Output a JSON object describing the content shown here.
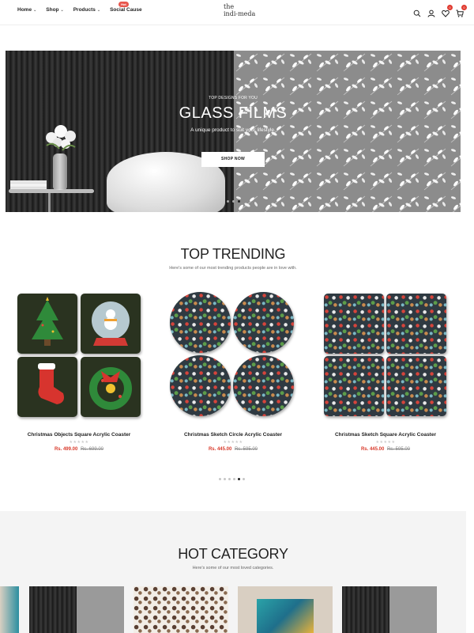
{
  "header": {
    "nav": [
      {
        "label": "Home",
        "has_dropdown": true
      },
      {
        "label": "Shop",
        "has_dropdown": true
      },
      {
        "label": "Products",
        "has_dropdown": true
      },
      {
        "label": "Social Cause",
        "has_dropdown": false,
        "badge": "Hot"
      }
    ],
    "logo_line1": "the",
    "logo_line2": "indi-meda",
    "icons": [
      "search-icon",
      "user-icon",
      "wishlist-icon",
      "cart-icon"
    ],
    "wishlist_count": "0",
    "cart_count": "0"
  },
  "hero": {
    "kicker": "TOP DESIGNS FOR YOU",
    "title": "GLASS FILMS",
    "subtitle": "A unique product to suit your lifestyle.",
    "button": "SHOP NOW",
    "slides": 3,
    "active_slide": 2
  },
  "trending": {
    "title": "TOP TRENDING",
    "subtitle": "Here's some of our most trending products people are in love with.",
    "products": [
      {
        "name": "Christmas Objects Square Acrylic Coaster",
        "price": "Rs. 499.00",
        "old_price": "Rs. 699.00",
        "rating": "★★★★★"
      },
      {
        "name": "Christmas Sketch Circle Acrylic Coaster",
        "price": "Rs. 445.00",
        "old_price": "Rs. 595.00",
        "rating": "★★★★★"
      },
      {
        "name": "Christmas Sketch Square Acrylic Coaster",
        "price": "Rs. 445.00",
        "old_price": "Rs. 595.00",
        "rating": "★★★★★"
      }
    ],
    "dots": 6,
    "active_dot": 4
  },
  "hot_category": {
    "title": "HOT CATEGORY",
    "subtitle": "Here's some of our most loved categories."
  },
  "colors": {
    "accent": "#e03a2f",
    "price": "#d93a2b",
    "section_bg": "#f4f4f4"
  }
}
